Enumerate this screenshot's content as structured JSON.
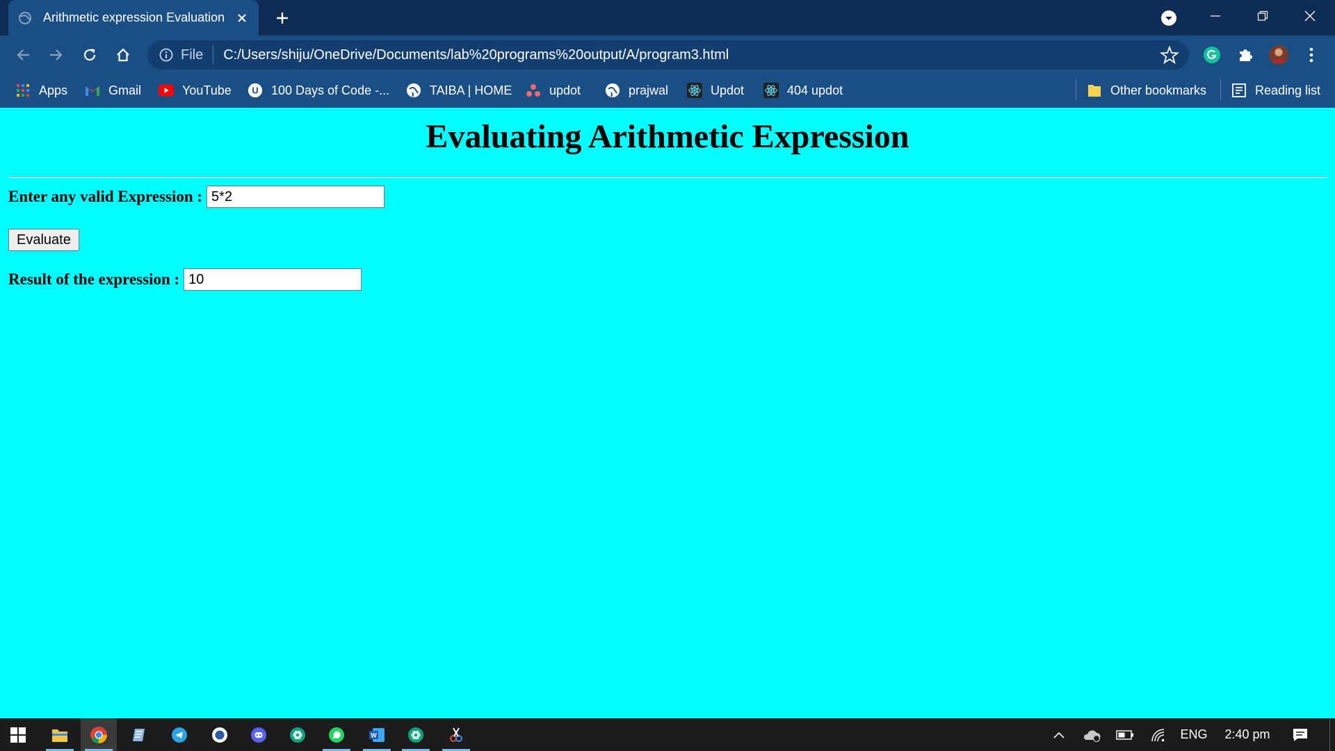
{
  "browser": {
    "tab_title": "Arithmetic expression Evaluation",
    "url_scheme": "File",
    "url": "C:/Users/shiju/OneDrive/Documents/lab%20programs%20output/A/program3.html",
    "bookmarks": [
      {
        "label": "Apps",
        "icon": "apps-grid-icon"
      },
      {
        "label": "Gmail",
        "icon": "gmail-icon"
      },
      {
        "label": "YouTube",
        "icon": "youtube-icon"
      },
      {
        "label": "100 Days of Code -...",
        "icon": "100-days-icon"
      },
      {
        "label": "TAIBA | HOME",
        "icon": "globe-icon"
      },
      {
        "label": "updot",
        "icon": "updot-icon"
      },
      {
        "label": "prajwal",
        "icon": "globe-icon"
      },
      {
        "label": "Updot",
        "icon": "react-icon"
      },
      {
        "label": "404 updot",
        "icon": "react-icon"
      }
    ],
    "other_bookmarks": "Other bookmarks",
    "reading_list": "Reading list"
  },
  "page": {
    "heading": "Evaluating Arithmetic Expression",
    "expression_label": "Enter any valid Expression :",
    "expression_value": "5*2",
    "evaluate_button": "Evaluate",
    "result_label": "Result of the expression :",
    "result_value": "10"
  },
  "taskbar": {
    "language": "ENG",
    "time": "2:40 pm"
  },
  "colors": {
    "page_background": "#00ffff",
    "chrome_tab_strip": "#0f2d54",
    "chrome_toolbar": "#1a4f86",
    "taskbar": "#1c1c1c"
  }
}
